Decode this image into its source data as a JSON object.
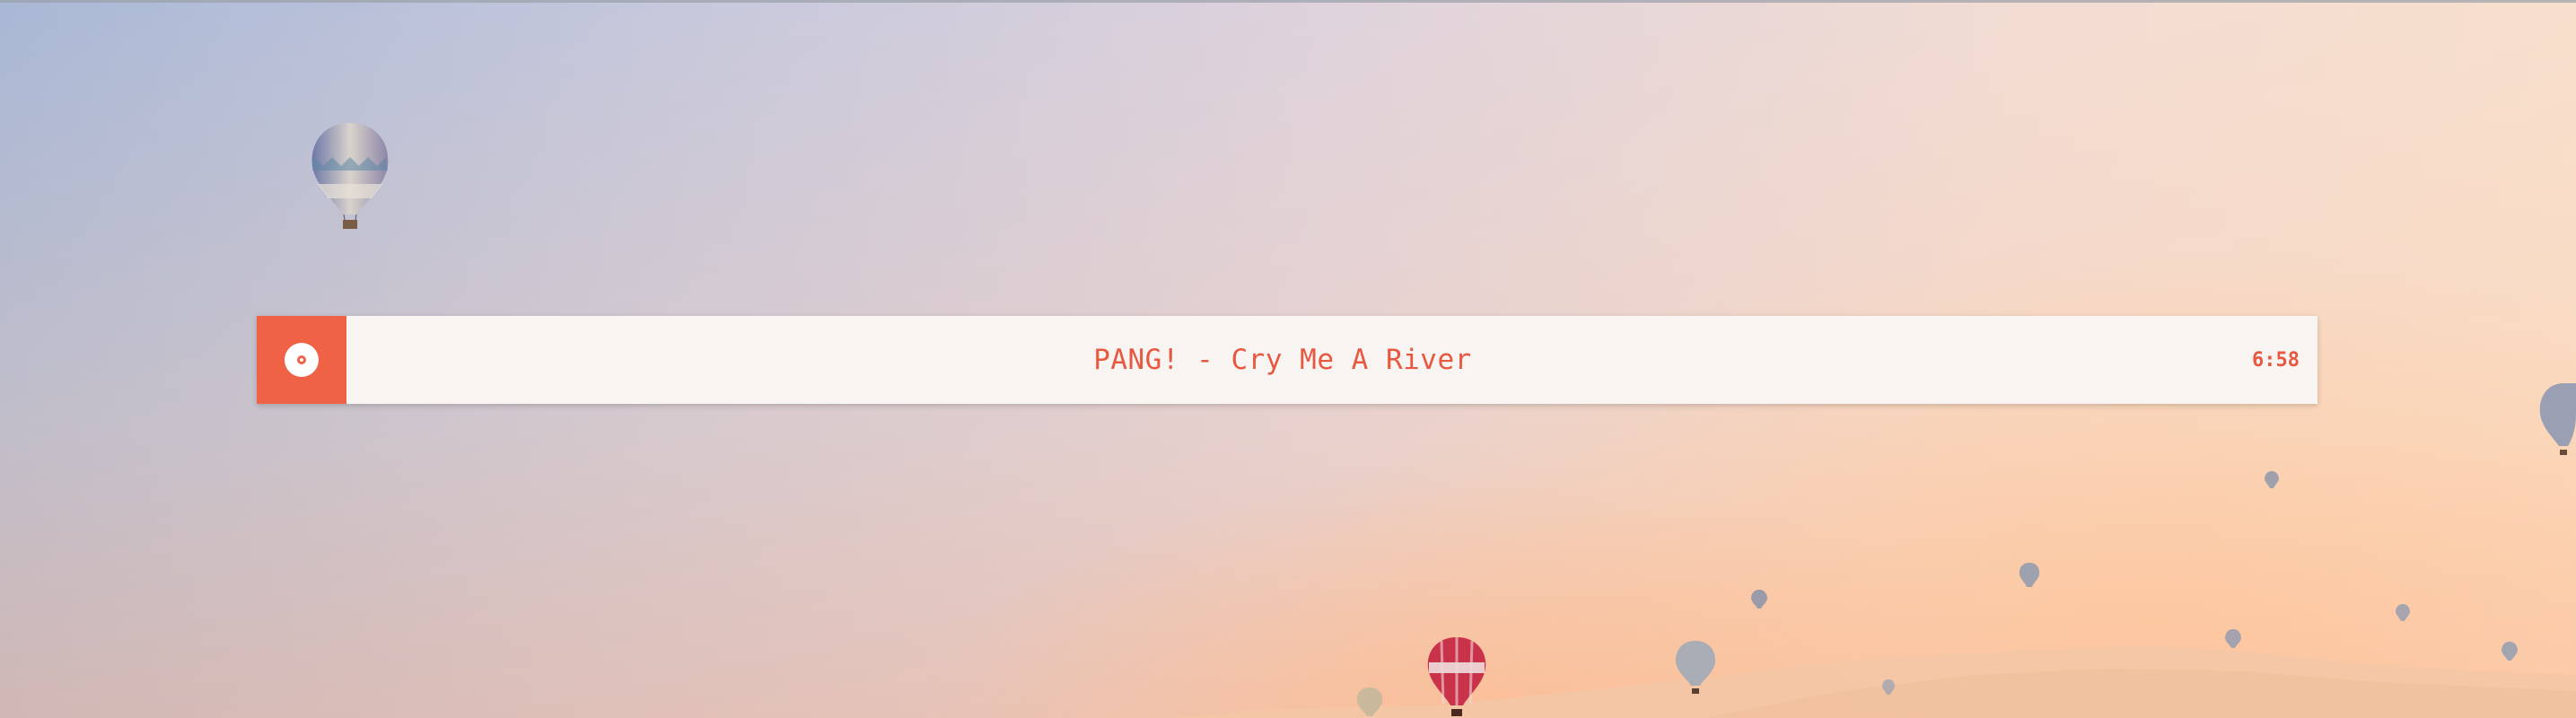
{
  "player": {
    "track": "PANG! - Cry Me A River",
    "duration": "6:58",
    "play_icon": "disc-icon",
    "accent_color": "#ef6245"
  },
  "background": {
    "scene": "hot-air-balloons-at-sunset"
  }
}
